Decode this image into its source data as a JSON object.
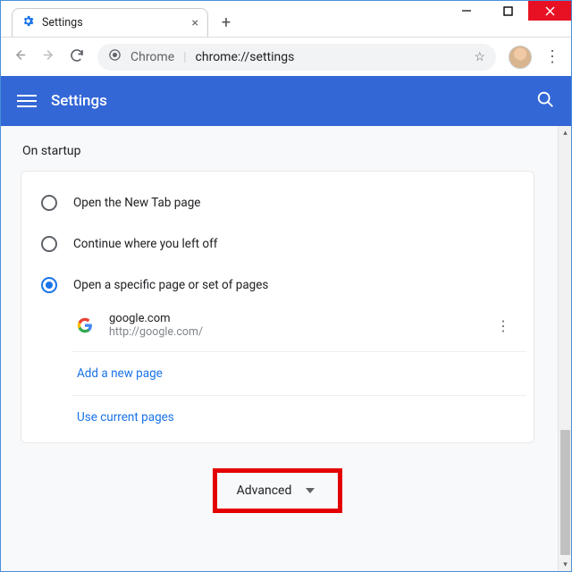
{
  "window": {
    "tab_title": "Settings",
    "omnibox_prefix": "Chrome",
    "omnibox_url": "chrome://settings"
  },
  "header": {
    "title": "Settings"
  },
  "section": {
    "label": "On startup",
    "options": {
      "new_tab": "Open the New Tab page",
      "continue": "Continue where you left off",
      "specific": "Open a specific page or set of pages"
    },
    "startup_page": {
      "title": "google.com",
      "url": "http://google.com/"
    },
    "links": {
      "add": "Add a new page",
      "use_current": "Use current pages"
    }
  },
  "advanced": {
    "label": "Advanced"
  }
}
